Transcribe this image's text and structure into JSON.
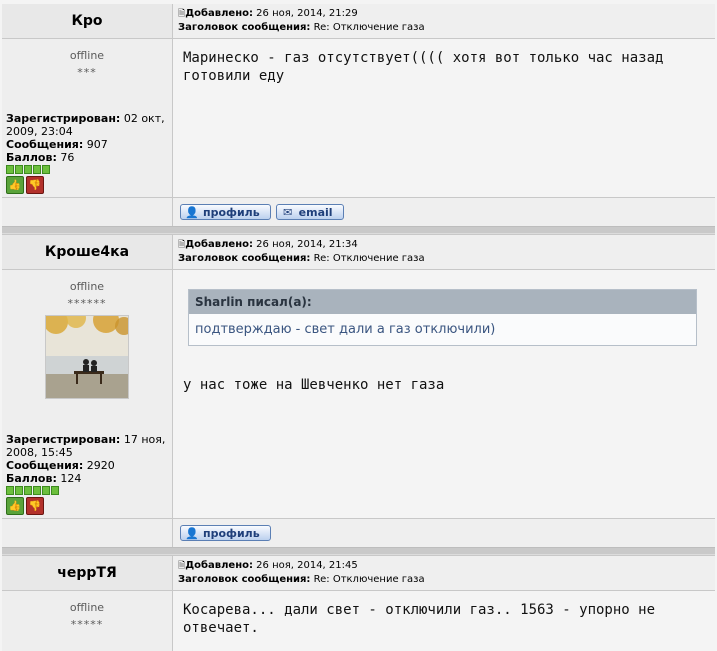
{
  "posts": [
    {
      "author": "Кро",
      "status": "offline",
      "stars": "***",
      "added_label": "Добавлено:",
      "added": "26 ноя, 2014, 21:29",
      "subject_label": "Заголовок сообщения:",
      "subject": "Re: Отключение газа",
      "registered_label": "Зарегистрирован:",
      "registered": "02 окт, 2009, 23:04",
      "messages_label": "Сообщения:",
      "messages": "907",
      "points_label": "Баллов:",
      "points": "76",
      "message": "Маринеско - газ отсутствует(((( хотя вот только час назад готовили еду",
      "buttons": [
        "профиль",
        "email"
      ]
    },
    {
      "author": "Кроше4ка",
      "status": "offline",
      "stars": "******",
      "added_label": "Добавлено:",
      "added": "26 ноя, 2014, 21:34",
      "subject_label": "Заголовок сообщения:",
      "subject": "Re: Отключение газа",
      "registered_label": "Зарегистрирован:",
      "registered": "17 ноя, 2008, 15:45",
      "messages_label": "Сообщения:",
      "messages": "2920",
      "points_label": "Баллов:",
      "points": "124",
      "quote_author": "Sharlin писал(а):",
      "quote_text": "подтверждаю - свет дали а газ отключили)",
      "message": "у нас тоже на Шевченко нет газа",
      "buttons": [
        "профиль"
      ]
    },
    {
      "author": "черрТЯ",
      "status": "offline",
      "stars": "*****",
      "added_label": "Добавлено:",
      "added": "26 ноя, 2014, 21:45",
      "subject_label": "Заголовок сообщения:",
      "subject": "Re: Отключение газа",
      "message": "Косарева... дали свет - отключили газ.. 1563 - упорно не отвечает."
    }
  ],
  "colors": {
    "rating_green": "#6cbf3c",
    "vote_up": "#5aa33a",
    "vote_down": "#b3312b",
    "quote_header": "#a9b3bd"
  }
}
